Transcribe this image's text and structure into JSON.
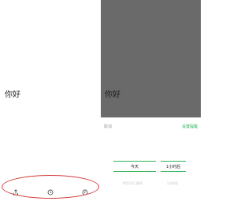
{
  "left_screen": {
    "note_text": "你好"
  },
  "right_screen": {
    "note_text": "你好",
    "sheet": {
      "cancel_label": "取消",
      "confirm_label": "设置提醒",
      "date_selected": "今天",
      "time_selected": "1小时后",
      "date_next": "9月22日 周四",
      "time_next": "2小时后"
    }
  },
  "colors": {
    "annotation": "#d63a3a",
    "accent": "#2fb35a",
    "dim_overlay": "#6a6a6a"
  },
  "icons": [
    "share-icon",
    "clock-icon",
    "alarm-icon"
  ]
}
